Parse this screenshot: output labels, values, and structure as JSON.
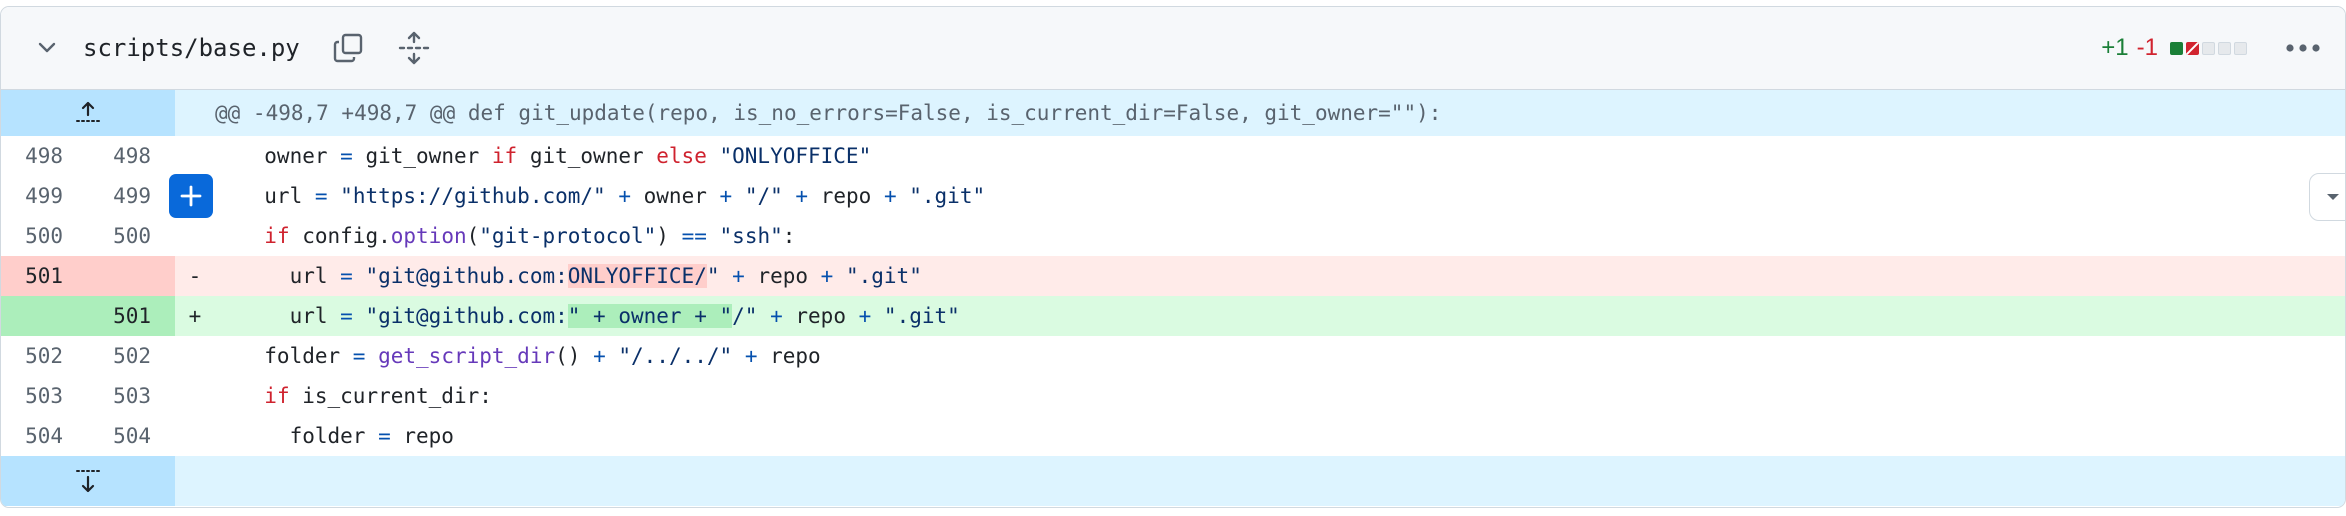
{
  "header": {
    "file_path": "scripts/base.py",
    "additions": "+1",
    "deletions": "-1",
    "diffstat_blocks": [
      "added",
      "removed",
      "neutral",
      "neutral",
      "neutral"
    ]
  },
  "hunk": {
    "header_text": "@@ -498,7 +498,7 @@ def git_update(repo, is_no_errors=False, is_current_dir=False, git_owner=\"\"):"
  },
  "lines": [
    {
      "old": "498",
      "new": "498",
      "marker": "",
      "type": "context"
    },
    {
      "old": "499",
      "new": "499",
      "marker": "",
      "type": "context"
    },
    {
      "old": "500",
      "new": "500",
      "marker": "",
      "type": "context"
    },
    {
      "old": "501",
      "new": "",
      "marker": "-",
      "type": "deletion"
    },
    {
      "old": "",
      "new": "501",
      "marker": "+",
      "type": "addition"
    },
    {
      "old": "502",
      "new": "502",
      "marker": "",
      "type": "context"
    },
    {
      "old": "503",
      "new": "503",
      "marker": "",
      "type": "context"
    },
    {
      "old": "504",
      "new": "504",
      "marker": "",
      "type": "context"
    }
  ],
  "code": {
    "l498": [
      "  owner ",
      "=",
      " git_owner ",
      "if",
      " git_owner ",
      "else",
      " ",
      "\"ONLYOFFICE\""
    ],
    "l499": [
      "  url ",
      "=",
      " ",
      "\"https://github.com/\"",
      " ",
      "+",
      " owner ",
      "+",
      " ",
      "\"/\"",
      " ",
      "+",
      " repo ",
      "+",
      " ",
      "\".git\""
    ],
    "l500": [
      "  ",
      "if",
      " config.",
      "option",
      "(",
      "\"git-protocol\"",
      ") ",
      "==",
      " ",
      "\"ssh\"",
      ":"
    ],
    "l501d": [
      "    url ",
      "=",
      " ",
      "\"git@github.com:",
      "ONLYOFFICE/",
      "\"",
      " ",
      "+",
      " repo ",
      "+",
      " ",
      "\".git\""
    ],
    "l501a": [
      "    url ",
      "=",
      " ",
      "\"git@github.com:",
      "\" + owner + \"",
      "/\"",
      " ",
      "+",
      " repo ",
      "+",
      " ",
      "\".git\""
    ],
    "l502": [
      "  folder ",
      "=",
      " ",
      "get_script_dir",
      "() ",
      "+",
      " ",
      "\"/../../\"",
      " ",
      "+",
      " repo"
    ],
    "l503": [
      "  ",
      "if",
      " is_current_dir:"
    ],
    "l504": [
      "    folder ",
      "=",
      " repo"
    ]
  },
  "icons": {
    "collapse": "chevron-down-icon",
    "copy": "copy-icon",
    "expand_all": "expand-icon",
    "more": "kebab-horizontal-icon",
    "expand_up": "fold-up-icon",
    "expand_down": "fold-down-icon",
    "add_comment": "plus-icon",
    "expand_right": "triangle-down-icon"
  },
  "colors": {
    "addition": "#1a7f37",
    "deletion": "#d1242f",
    "hunk_bg": "#ddf4ff",
    "del_bg": "#ffebe9",
    "add_bg": "#dafbe1"
  }
}
